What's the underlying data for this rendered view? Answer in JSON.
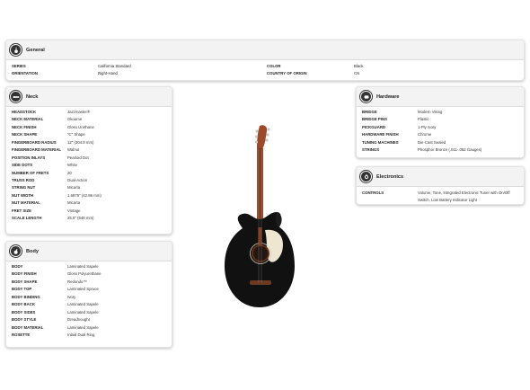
{
  "general": {
    "title": "General",
    "icon": "guitar-icon",
    "rows": [
      {
        "k1": "SERIES",
        "v1": "California Standard",
        "k2": "COLOR",
        "v2": "Black"
      },
      {
        "k1": "ORIENTATION",
        "v1": "Right-Hand",
        "k2": "COUNTRY OF ORIGIN",
        "v2": "CN"
      }
    ]
  },
  "neck": {
    "title": "Neck",
    "icon": "neck-icon",
    "rows": [
      {
        "k": "HEADSTOCK",
        "v": "Jazzmaster®"
      },
      {
        "k": "NECK MATERIAL",
        "v": "Okoume"
      },
      {
        "k": "NECK FINISH",
        "v": "Gloss Urethane"
      },
      {
        "k": "NECK SHAPE",
        "v": "\"C\" Shape"
      },
      {
        "k": "FINGERBOARD RADIUS",
        "v": "12\" (304.8 mm)"
      },
      {
        "k": "FINGERBOARD MATERIAL",
        "v": "Walnut"
      },
      {
        "k": "POSITION INLAYS",
        "v": "Pearloid Dot"
      },
      {
        "k": "SIDE DOTS",
        "v": "White"
      },
      {
        "k": "NUMBER OF FRETS",
        "v": "20"
      },
      {
        "k": "TRUSS ROD",
        "v": "Dual-Action"
      },
      {
        "k": "STRING NUT",
        "v": "Micarta"
      },
      {
        "k": "NUT WIDTH",
        "v": "1.6875\" (42.86 mm)"
      },
      {
        "k": "NUT MATERIAL",
        "v": "Micarta"
      },
      {
        "k": "FRET SIZE",
        "v": "Vintage"
      },
      {
        "k": "SCALE LENGTH",
        "v": "25.5\" (648 mm)"
      }
    ]
  },
  "body": {
    "title": "Body",
    "icon": "body-icon",
    "rows": [
      {
        "k": "BODY",
        "v": "Laminated Sapele"
      },
      {
        "k": "BODY FINISH",
        "v": "Gloss Polyurethane"
      },
      {
        "k": "BODY SHAPE",
        "v": "Redondo™"
      },
      {
        "k": "BODY TOP",
        "v": "Laminated Spruce"
      },
      {
        "k": "BODY BINDING",
        "v": "Ivory"
      },
      {
        "k": "BODY BACK",
        "v": "Laminated Sapele"
      },
      {
        "k": "BODY SIDES",
        "v": "Laminated Sapele"
      },
      {
        "k": "BODY STYLE",
        "v": "Dreadnought"
      },
      {
        "k": "BODY MATERIAL",
        "v": "Laminated Sapele"
      },
      {
        "k": "ROSETTE",
        "v": "Inlaid Dual Ring"
      }
    ]
  },
  "hardware": {
    "title": "Hardware",
    "icon": "hardware-icon",
    "rows": [
      {
        "k": "BRIDGE",
        "v": "Modern Viking"
      },
      {
        "k": "BRIDGE PINS",
        "v": "Plastic"
      },
      {
        "k": "PICKGUARD",
        "v": "1-Ply Ivory"
      },
      {
        "k": "HARDWARE FINISH",
        "v": "Chrome"
      },
      {
        "k": "TUNING MACHINES",
        "v": "Die-Cast Sealed"
      },
      {
        "k": "STRINGS",
        "v": "Phosphor Bronze (.011-.052 Gauges)"
      }
    ]
  },
  "electronics": {
    "title": "Electronics",
    "icon": "electronics-icon",
    "rows": [
      {
        "k": "CONTROLS",
        "v": "Volume, Tone, Integrated Electronic Tuner with On/Off Switch, Low Battery Indicator Light"
      }
    ]
  },
  "colors": {
    "body_finish": "#111111",
    "neck_wood": "#9c4a2a",
    "pickguard": "#efe6d2"
  }
}
